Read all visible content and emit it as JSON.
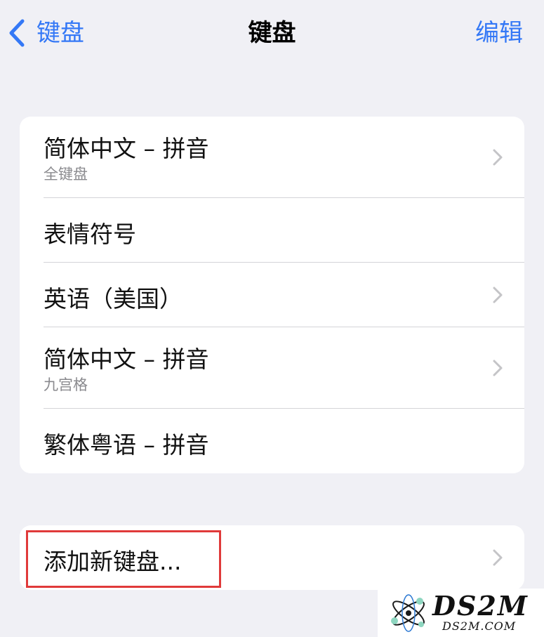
{
  "nav": {
    "back_label": "键盘",
    "title": "键盘",
    "edit_label": "编辑"
  },
  "keyboards": [
    {
      "title": "简体中文 – 拼音",
      "subtitle": "全键盘",
      "chevron": true
    },
    {
      "title": "表情符号",
      "subtitle": "",
      "chevron": false
    },
    {
      "title": "英语（美国）",
      "subtitle": "",
      "chevron": true
    },
    {
      "title": "简体中文 – 拼音",
      "subtitle": "九宫格",
      "chevron": true
    },
    {
      "title": "繁体粤语 – 拼音",
      "subtitle": "",
      "chevron": false
    }
  ],
  "add_keyboard": {
    "label": "添加新键盘..."
  },
  "watermark": {
    "brand": "DS2M",
    "url": "DS2M.COM"
  },
  "colors": {
    "accent": "#3478f6",
    "background": "#f0f0f5",
    "highlight": "#e03a3a"
  }
}
